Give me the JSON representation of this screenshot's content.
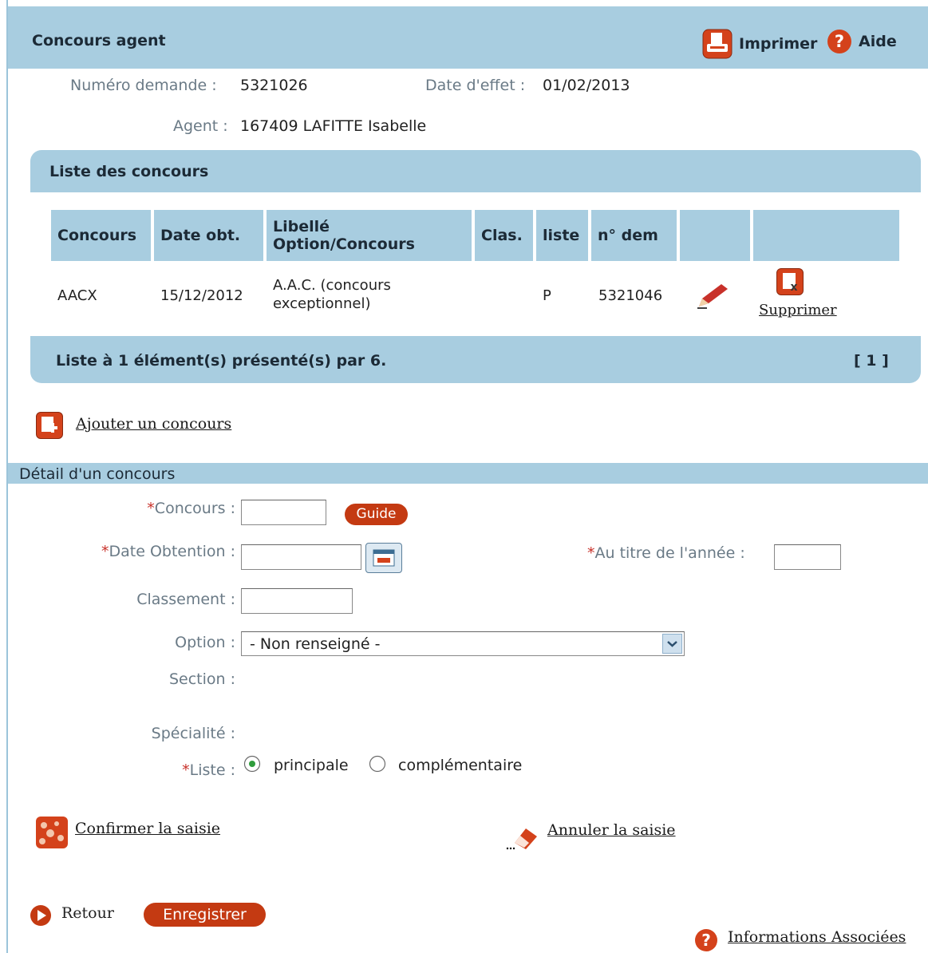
{
  "header": {
    "title": "Concours agent",
    "print_label": "Imprimer",
    "help_label": "Aide"
  },
  "info": {
    "numero_label": "Numéro demande :",
    "numero_value": "5321026",
    "date_label": "Date d'effet :",
    "date_value": "01/02/2013",
    "agent_label": "Agent :",
    "agent_value": "167409 LAFITTE Isabelle"
  },
  "list": {
    "title": "Liste des concours",
    "columns": [
      "Concours",
      "Date obt.",
      "Libellé Option/Concours",
      "Clas.",
      "liste",
      "n° dem"
    ],
    "rows": [
      {
        "concours": "AACX",
        "date": "15/12/2012",
        "libelle": "A.A.C. (concours exceptionnel)",
        "clas": "",
        "liste": "P",
        "ndem": "5321046",
        "delete_label": "Supprimer"
      }
    ],
    "footer": "Liste à 1 élément(s) présenté(s) par 6.",
    "pagination": "[ 1 ]"
  },
  "add_link": "Ajouter un concours",
  "detail": {
    "title": "Détail d'un concours",
    "concours_label": "Concours :",
    "guide_label": "Guide",
    "date_label": "Date Obtention :",
    "annee_label": "Au titre de l'année :",
    "classement_label": "Classement :",
    "option_label": "Option :",
    "option_value": "- Non renseigné -",
    "section_label": "Section :",
    "specialite_label": "Spécialité :",
    "liste_label": "Liste :",
    "radio_principale": "principale",
    "radio_complementaire": "complémentaire",
    "required_mark": "*"
  },
  "actions": {
    "confirm": "Confirmer la saisie",
    "cancel": "Annuler la saisie",
    "back": "Retour",
    "save": "Enregistrer",
    "info": "Informations Associées"
  },
  "colors": {
    "header_bg": "#a8cde0",
    "accent": "#c43a12"
  },
  "icons": [
    "printer-icon",
    "help-icon",
    "edit-pencil-icon",
    "delete-icon",
    "add-icon",
    "calendar-icon",
    "dropdown-arrow-icon",
    "confirm-icon",
    "eraser-icon",
    "play-icon"
  ]
}
